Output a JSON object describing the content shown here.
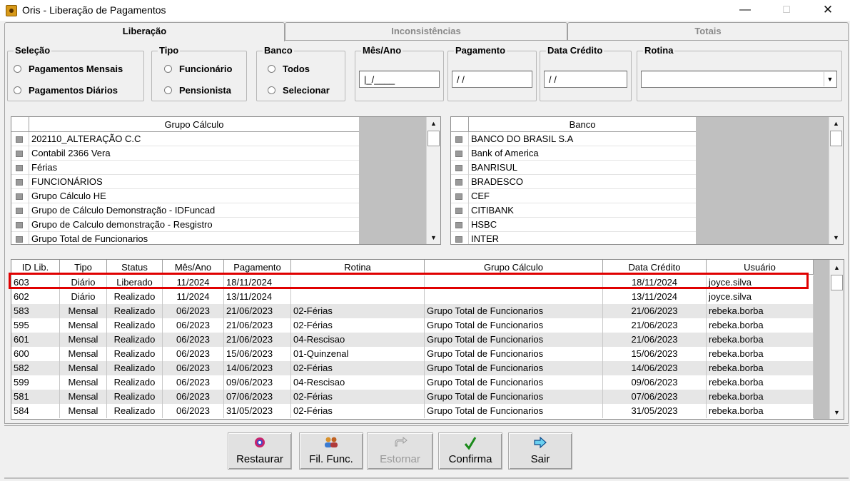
{
  "window": {
    "title": "Oris - Liberação de Pagamentos"
  },
  "tabs": [
    {
      "label": "Liberação"
    },
    {
      "label": "Inconsistências"
    },
    {
      "label": "Totais"
    }
  ],
  "selecao": {
    "legend": "Seleção",
    "options": [
      "Pagamentos Mensais",
      "Pagamentos Diários"
    ]
  },
  "tipo": {
    "legend": "Tipo",
    "options": [
      "Funcionário",
      "Pensionista"
    ]
  },
  "banco_filter": {
    "legend": "Banco",
    "options": [
      "Todos",
      "Selecionar"
    ]
  },
  "mes_ano": {
    "legend": "Mês/Ano",
    "value": "|_/____"
  },
  "pagamento": {
    "legend": "Pagamento",
    "value": "/ /"
  },
  "data_credito": {
    "legend": "Data Crédito",
    "value": "/ /"
  },
  "rotina": {
    "legend": "Rotina",
    "value": ""
  },
  "grupo_calculo_list": {
    "header": "Grupo Cálculo",
    "items": [
      "202110_ALTERAÇÃO C.C",
      "Contabil 2366 Vera",
      "Férias",
      "FUNCIONÁRIOS",
      "Grupo Cálculo HE",
      "Grupo de Cálculo Demonstração - IDFuncad",
      "Grupo de Calculo demonstração - Resgistro",
      "Grupo Total de Funcionarios"
    ]
  },
  "banco_list": {
    "header": "Banco",
    "items": [
      "BANCO DO BRASIL S.A",
      "Bank of America",
      "BANRISUL",
      "BRADESCO",
      "CEF",
      "CITIBANK",
      "HSBC",
      "INTER"
    ]
  },
  "grid": {
    "columns": [
      "ID Lib.",
      "Tipo",
      "Status",
      "Mês/Ano",
      "Pagamento",
      "Rotina",
      "Grupo Cálculo",
      "Data Crédito",
      "Usuário"
    ],
    "rows": [
      [
        "603",
        "Diário",
        "Liberado",
        "11/2024",
        "18/11/2024",
        "",
        "",
        "18/11/2024",
        "joyce.silva"
      ],
      [
        "602",
        "Diário",
        "Realizado",
        "11/2024",
        "13/11/2024",
        "",
        "",
        "13/11/2024",
        "joyce.silva"
      ],
      [
        "583",
        "Mensal",
        "Realizado",
        "06/2023",
        "21/06/2023",
        "02-Férias",
        "Grupo Total de Funcionarios",
        "21/06/2023",
        "rebeka.borba"
      ],
      [
        "595",
        "Mensal",
        "Realizado",
        "06/2023",
        "21/06/2023",
        "02-Férias",
        "Grupo Total de Funcionarios",
        "21/06/2023",
        "rebeka.borba"
      ],
      [
        "601",
        "Mensal",
        "Realizado",
        "06/2023",
        "21/06/2023",
        "04-Rescisao",
        "Grupo Total de Funcionarios",
        "21/06/2023",
        "rebeka.borba"
      ],
      [
        "600",
        "Mensal",
        "Realizado",
        "06/2023",
        "15/06/2023",
        "01-Quinzenal",
        "Grupo Total de Funcionarios",
        "15/06/2023",
        "rebeka.borba"
      ],
      [
        "582",
        "Mensal",
        "Realizado",
        "06/2023",
        "14/06/2023",
        "02-Férias",
        "Grupo Total de Funcionarios",
        "14/06/2023",
        "rebeka.borba"
      ],
      [
        "599",
        "Mensal",
        "Realizado",
        "06/2023",
        "09/06/2023",
        "04-Rescisao",
        "Grupo Total de Funcionarios",
        "09/06/2023",
        "rebeka.borba"
      ],
      [
        "581",
        "Mensal",
        "Realizado",
        "06/2023",
        "07/06/2023",
        "02-Férias",
        "Grupo Total de Funcionarios",
        "07/06/2023",
        "rebeka.borba"
      ],
      [
        "584",
        "Mensal",
        "Realizado",
        "06/2023",
        "31/05/2023",
        "02-Férias",
        "Grupo Total de Funcionarios",
        "31/05/2023",
        "rebeka.borba"
      ]
    ]
  },
  "buttons": [
    {
      "label": "Restaurar",
      "icon": "restore-icon",
      "enabled": true
    },
    {
      "label": "Fil. Func.",
      "icon": "users-filter-icon",
      "enabled": true
    },
    {
      "label": "Estornar",
      "icon": "undo-arrow-icon",
      "enabled": false
    },
    {
      "label": "Confirma",
      "icon": "checkmark-icon",
      "enabled": true
    },
    {
      "label": "Sair",
      "icon": "exit-arrow-icon",
      "enabled": true
    }
  ],
  "colors": {
    "highlight": "#e00000",
    "panel": "#f0f0f0",
    "checkmark": "#1a8a1a",
    "exit_arrow": "#1a7ad6"
  }
}
